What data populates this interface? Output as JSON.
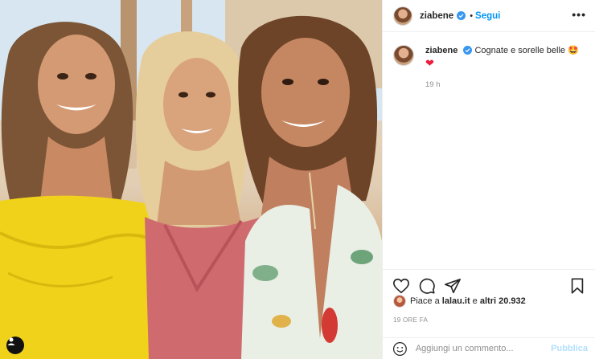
{
  "post": {
    "username": "ziabene",
    "follow_label": "Segui",
    "more_label": "•••",
    "separator": "•"
  },
  "caption": {
    "username": "ziabene",
    "text": "Cognate e sorelle belle 🤩",
    "second_line": "❤",
    "time": "19 h"
  },
  "likes": {
    "prefix": "Piace a ",
    "liker": "lalau.it",
    "middle": " e ",
    "others": "altri 20.932"
  },
  "post_time": "19 ORE FA",
  "comment": {
    "placeholder": "Aggiungi un commento...",
    "publish_label": "Pubblica"
  },
  "icons": {
    "verified": "verified-badge-icon",
    "like": "heart-icon",
    "comment": "comment-bubble-icon",
    "share": "paper-plane-icon",
    "save": "bookmark-icon",
    "emoji": "smiley-icon",
    "tag": "user-tag-icon"
  },
  "colors": {
    "accent": "#0095f6",
    "verified": "#3897f0",
    "publish_disabled": "#b2dffc",
    "muted": "#8e8e8e"
  }
}
